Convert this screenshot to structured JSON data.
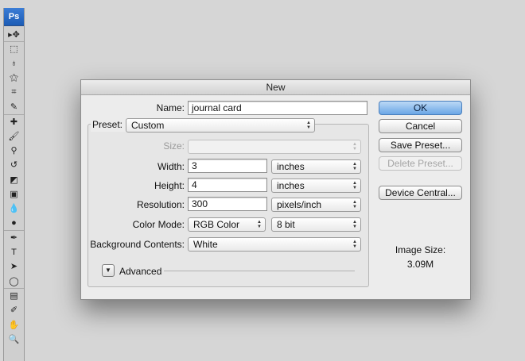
{
  "app": {
    "logo": "Ps"
  },
  "tools": [
    {
      "name": "move-tool-icon",
      "glyph": "▸✥",
      "sep": false
    },
    {
      "name": "marquee-tool-icon",
      "glyph": "⬚",
      "sep": true
    },
    {
      "name": "lasso-tool-icon",
      "glyph": "♁",
      "sep": false
    },
    {
      "name": "magic-wand-tool-icon",
      "glyph": "⚝",
      "sep": false
    },
    {
      "name": "crop-tool-icon",
      "glyph": "⌗",
      "sep": false
    },
    {
      "name": "eyedropper-tool-icon",
      "glyph": "✎",
      "sep": false
    },
    {
      "name": "healing-brush-tool-icon",
      "glyph": "✚",
      "sep": true
    },
    {
      "name": "brush-tool-icon",
      "glyph": "🖌",
      "sep": false
    },
    {
      "name": "clone-stamp-tool-icon",
      "glyph": "⚲",
      "sep": false
    },
    {
      "name": "history-brush-tool-icon",
      "glyph": "↺",
      "sep": false
    },
    {
      "name": "eraser-tool-icon",
      "glyph": "◩",
      "sep": false
    },
    {
      "name": "gradient-tool-icon",
      "glyph": "▣",
      "sep": false
    },
    {
      "name": "blur-tool-icon",
      "glyph": "💧",
      "sep": false
    },
    {
      "name": "dodge-tool-icon",
      "glyph": "●",
      "sep": false
    },
    {
      "name": "pen-tool-icon",
      "glyph": "✒",
      "sep": true
    },
    {
      "name": "type-tool-icon",
      "glyph": "T",
      "sep": false
    },
    {
      "name": "path-selection-tool-icon",
      "glyph": "➤",
      "sep": false
    },
    {
      "name": "shape-tool-icon",
      "glyph": "◯",
      "sep": false
    },
    {
      "name": "notes-tool-icon",
      "glyph": "▤",
      "sep": true
    },
    {
      "name": "color-sampler-tool-icon",
      "glyph": "✐",
      "sep": false
    },
    {
      "name": "hand-tool-icon",
      "glyph": "✋",
      "sep": false
    },
    {
      "name": "zoom-tool-icon",
      "glyph": "🔍",
      "sep": false
    }
  ],
  "dialog": {
    "title": "New",
    "name_label": "Name:",
    "name_value": "journal card",
    "preset_label": "Preset:",
    "preset_value": "Custom",
    "size_label": "Size:",
    "size_value": "",
    "width_label": "Width:",
    "width_value": "3",
    "width_unit": "inches",
    "height_label": "Height:",
    "height_value": "4",
    "height_unit": "inches",
    "resolution_label": "Resolution:",
    "resolution_value": "300",
    "resolution_unit": "pixels/inch",
    "color_mode_label": "Color Mode:",
    "color_mode_value": "RGB Color",
    "bit_depth_value": "8 bit",
    "background_label": "Background Contents:",
    "background_value": "White",
    "advanced_label": "Advanced",
    "ok_label": "OK",
    "cancel_label": "Cancel",
    "save_preset_label": "Save Preset...",
    "delete_preset_label": "Delete Preset...",
    "device_central_label": "Device Central...",
    "image_size_label": "Image Size:",
    "image_size_value": "3.09M"
  }
}
